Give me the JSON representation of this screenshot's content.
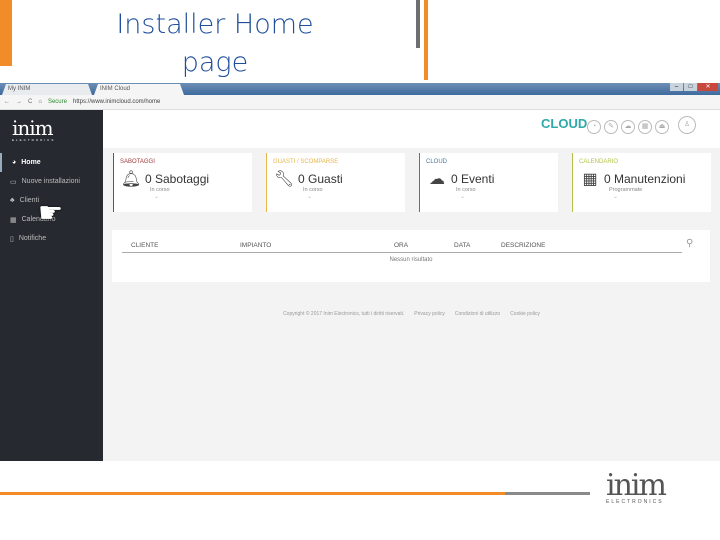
{
  "slide": {
    "title": "Installer Home page",
    "brand": "inim",
    "brand_sub": "ELECTRONICS"
  },
  "browser": {
    "tabs": [
      "My INIM",
      "INIM Cloud"
    ],
    "secure": "Secure",
    "url": "https://www.inimcloud.com/home"
  },
  "sidebar": {
    "logo": "inim",
    "logo_sub": "ELECTRONICS",
    "items": [
      "Home",
      "Nuove installazioni",
      "Clienti",
      "Calendario",
      "Notifiche"
    ]
  },
  "header": {
    "cloud_logo": "CLOUD"
  },
  "cards": [
    {
      "title": "SABOTAGGI",
      "value": "0 Sabotaggi",
      "sub": "In corso",
      "color": "#a33b3b",
      "icon": "bell-icon"
    },
    {
      "title": "GUASTI / SCOMPARSE",
      "value": "0 Guasti",
      "sub": "In corso",
      "color": "#e8b64a",
      "icon": "wrench-icon"
    },
    {
      "title": "CLOUD",
      "value": "0 Eventi",
      "sub": "In corso",
      "color": "#4a7a9a",
      "icon": "cloud-icon"
    },
    {
      "title": "CALENDARIO",
      "value": "0 Manutenzioni",
      "sub": "Programmate",
      "color": "#b5c24a",
      "icon": "calendar-icon"
    }
  ],
  "table": {
    "columns": [
      "CLIENTE",
      "IMPIANTO",
      "ORA",
      "DATA",
      "DESCRIZIONE"
    ],
    "empty": "Nessun risultato"
  },
  "footer": [
    "Copyright © 2017 Inim Electronics, tutti i diritti riservati.",
    "Privacy policy",
    "Condizioni di utilizzo",
    "Cookie policy"
  ]
}
